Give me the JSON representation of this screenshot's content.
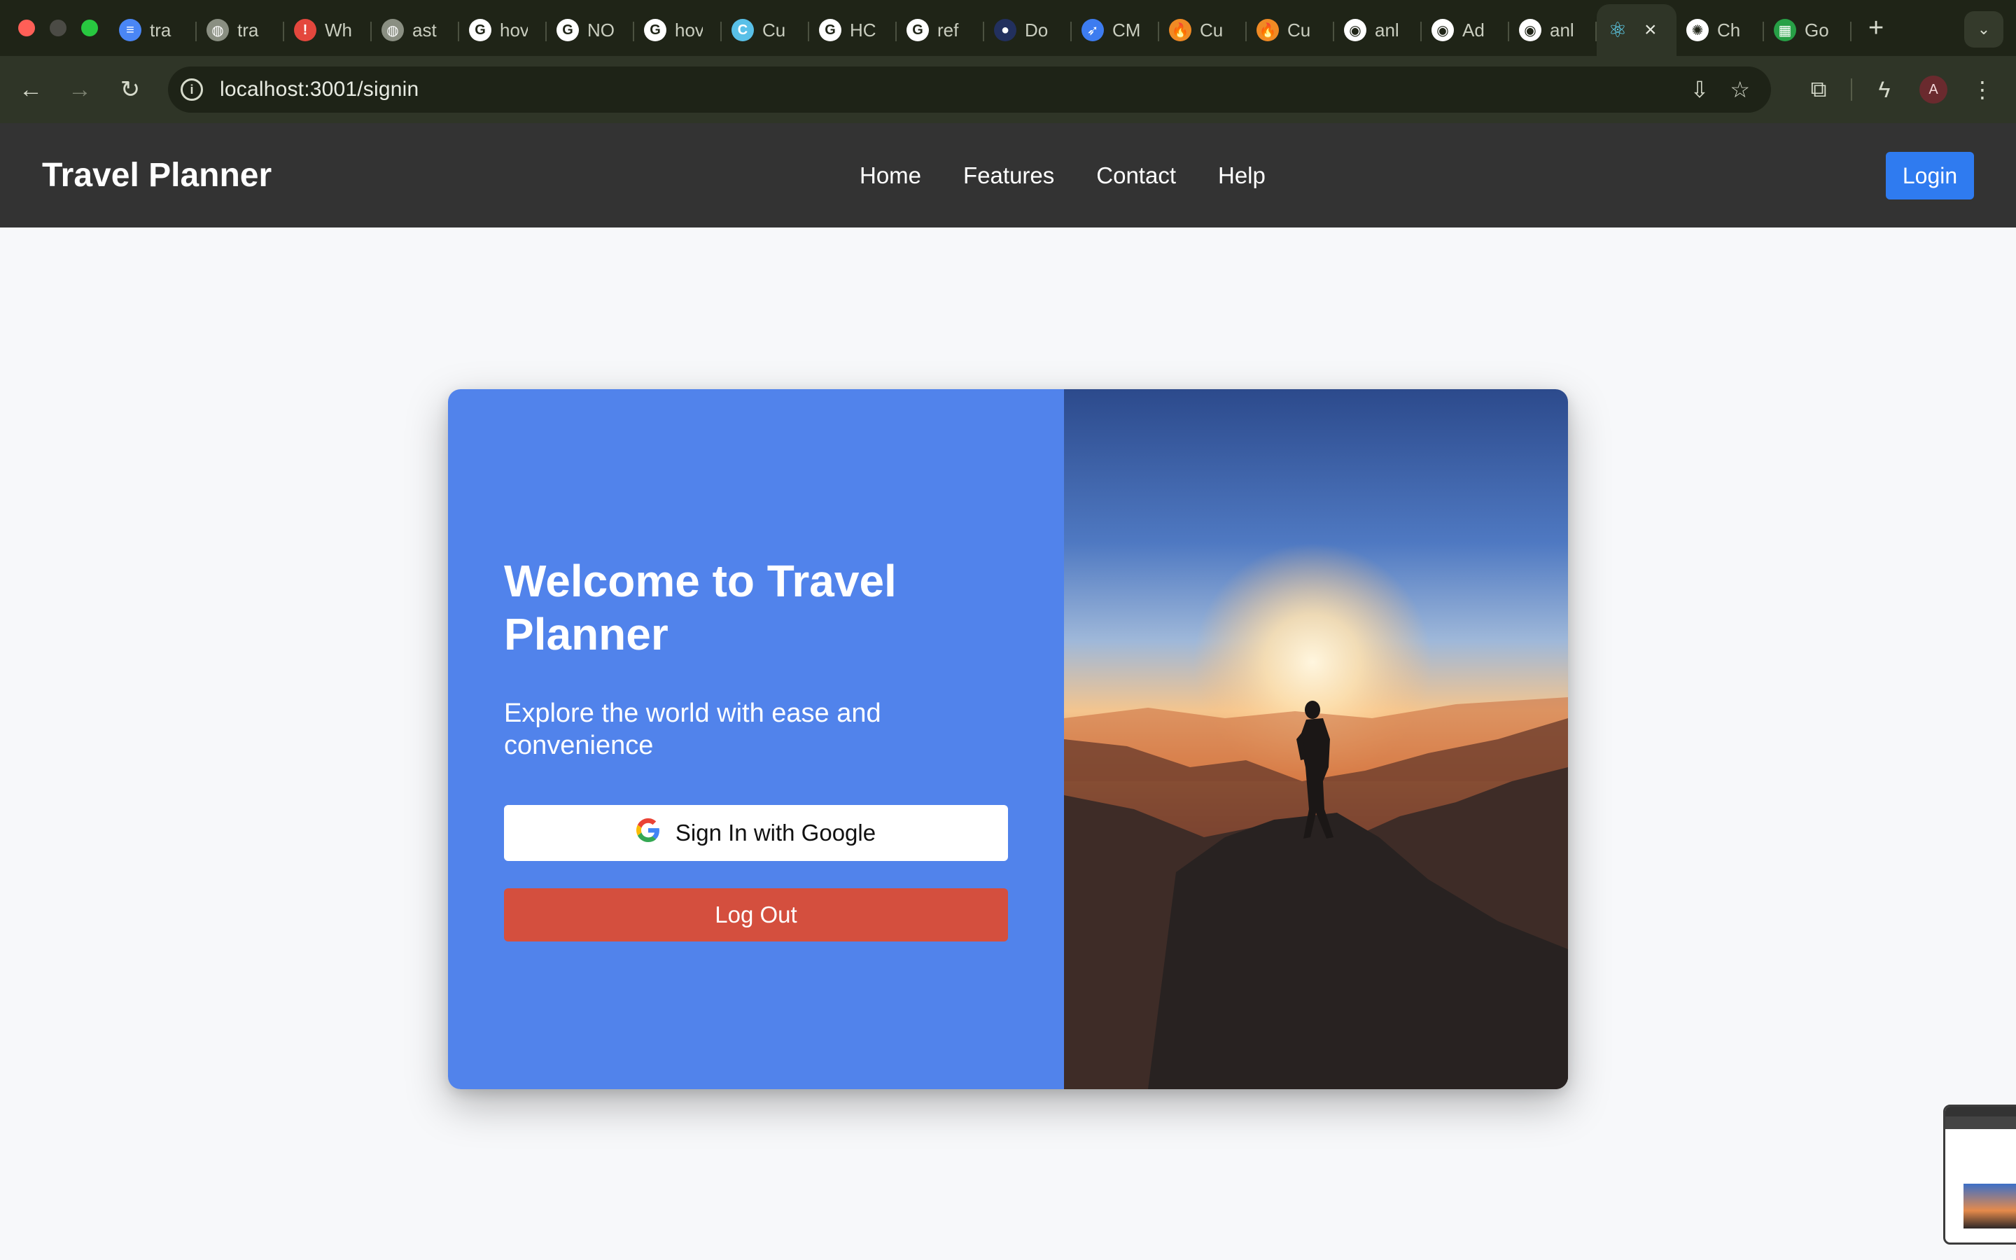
{
  "browser": {
    "tabs": [
      {
        "title": "tra",
        "icon": "docs-icon",
        "color": "#4a86f5"
      },
      {
        "title": "tra",
        "icon": "globe-icon",
        "color": "#8a8f82"
      },
      {
        "title": "Wh",
        "icon": "alert-icon",
        "color": "#e4473d"
      },
      {
        "title": "ast",
        "icon": "globe-icon",
        "color": "#8a8f82"
      },
      {
        "title": "hov",
        "icon": "google-icon",
        "color": "#ffffff"
      },
      {
        "title": "NO",
        "icon": "google-icon",
        "color": "#ffffff"
      },
      {
        "title": "hov",
        "icon": "google-icon",
        "color": "#ffffff"
      },
      {
        "title": "Cu",
        "icon": "cursor-icon",
        "color": "#59c0e8"
      },
      {
        "title": "HC",
        "icon": "google-icon",
        "color": "#ffffff"
      },
      {
        "title": "ref",
        "icon": "google-icon",
        "color": "#ffffff"
      },
      {
        "title": "Do",
        "icon": "circle-icon",
        "color": "#22305e"
      },
      {
        "title": "CM",
        "icon": "jira-icon",
        "color": "#3d7cf0"
      },
      {
        "title": "Cu",
        "icon": "flame-icon",
        "color": "#f08a24"
      },
      {
        "title": "Cu",
        "icon": "flame-icon",
        "color": "#f08a24"
      },
      {
        "title": "anl",
        "icon": "github-icon",
        "color": "#ffffff"
      },
      {
        "title": "Ad",
        "icon": "github-icon",
        "color": "#ffffff"
      },
      {
        "title": "anl",
        "icon": "github-icon",
        "color": "#ffffff"
      }
    ],
    "active_tab": {
      "icon": "react-icon",
      "color": "#61dafb",
      "close": "×"
    },
    "after_tabs": [
      {
        "title": "Ch",
        "icon": "openai-icon",
        "color": "#ffffff"
      },
      {
        "title": "Go",
        "icon": "sheets-icon",
        "color": "#27a046"
      }
    ],
    "new_tab": "+",
    "url": "localhost:3001/signin",
    "avatar_letter": "A"
  },
  "header": {
    "brand": "Travel Planner",
    "nav": [
      "Home",
      "Features",
      "Contact",
      "Help"
    ],
    "login_label": "Login"
  },
  "signin": {
    "title": "Welcome to Travel Planner",
    "tagline": "Explore the world with ease and convenience",
    "google_label": "Sign In with Google",
    "logout_label": "Log Out",
    "panel_color": "#5183eb",
    "logout_color": "#d44f3e"
  }
}
